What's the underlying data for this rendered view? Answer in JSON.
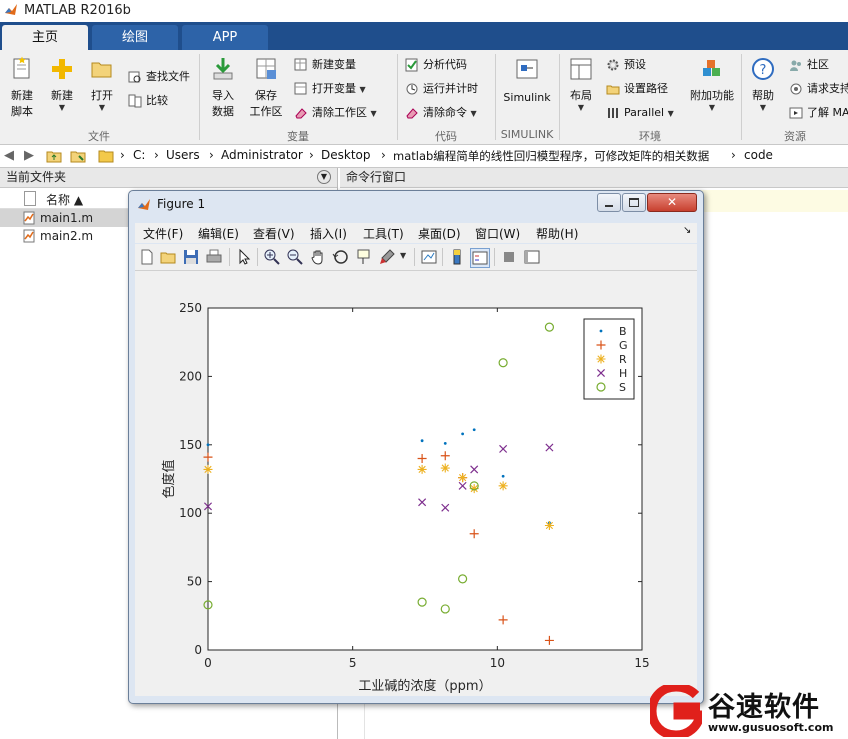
{
  "window": {
    "title": "MATLAB R2016b"
  },
  "tabs": [
    {
      "label": "主页",
      "active": true
    },
    {
      "label": "绘图",
      "active": false
    },
    {
      "label": "APP",
      "active": false
    }
  ],
  "ribbon": {
    "groups": [
      "文件",
      "变量",
      "代码",
      "SIMULINK",
      "环境",
      "资源"
    ],
    "file": {
      "new_script": [
        "新建",
        "脚本"
      ],
      "new": "新建",
      "open": "打开",
      "find_files": "查找文件",
      "compare": "比较"
    },
    "variable": {
      "import": [
        "导入",
        "数据"
      ],
      "save": [
        "保存",
        "工作区"
      ],
      "new_var": "新建变量",
      "open_var": "打开变量",
      "clear_ws": "清除工作区"
    },
    "code": {
      "analyze": "分析代码",
      "run_time": "运行并计时",
      "clear_cmd": "清除命令"
    },
    "simulink": {
      "label": "Simulink"
    },
    "environment": {
      "layout": "布局",
      "prefs": "预设",
      "set_path": "设置路径",
      "parallel": "Parallel",
      "addons": "附加功能"
    },
    "resources": {
      "help": "帮助",
      "community": "社区",
      "request_support": "请求支持",
      "learn": "了解 MA"
    }
  },
  "address": {
    "crumbs": [
      "C:",
      "Users",
      "Administrator",
      "Desktop",
      "matlab编程简单的线性回归模型程序，可修改矩阵的相关数据",
      "code"
    ]
  },
  "current_folder": {
    "header": "当前文件夹",
    "col_name": "名称 ▲",
    "files": [
      "main1.m",
      "main2.m"
    ]
  },
  "command_window": {
    "header": "命令行窗口"
  },
  "figure": {
    "title": "Figure 1",
    "menu": [
      "文件(F)",
      "编辑(E)",
      "查看(V)",
      "插入(I)",
      "工具(T)",
      "桌面(D)",
      "窗口(W)",
      "帮助(H)"
    ]
  },
  "chart_data": {
    "type": "scatter",
    "title": "",
    "xlabel": "工业碱的浓度（ppm）",
    "ylabel": "色度值",
    "xlim": [
      0,
      15
    ],
    "ylim": [
      0,
      250
    ],
    "xticks": [
      0,
      5,
      10,
      15
    ],
    "yticks": [
      0,
      50,
      100,
      150,
      200,
      250
    ],
    "legend_position": "top-right",
    "series": [
      {
        "name": "B",
        "marker": "point",
        "color": "#0072bd",
        "x": [
          0,
          7.4,
          8.2,
          8.8,
          9.2,
          10.2,
          11.8
        ],
        "y": [
          150,
          153,
          151,
          158,
          161,
          127,
          93
        ]
      },
      {
        "name": "G",
        "marker": "plus",
        "color": "#d95319",
        "x": [
          0,
          7.4,
          8.2,
          8.8,
          9.2,
          10.2,
          11.8
        ],
        "y": [
          141,
          140,
          142,
          126,
          85,
          22,
          7
        ]
      },
      {
        "name": "R",
        "marker": "asterisk",
        "color": "#edb120",
        "x": [
          0,
          7.4,
          8.2,
          8.8,
          9.2,
          10.2,
          11.8
        ],
        "y": [
          132,
          132,
          133,
          126,
          118,
          120,
          91
        ]
      },
      {
        "name": "H",
        "marker": "cross",
        "color": "#7e2f8e",
        "x": [
          0,
          7.4,
          8.2,
          8.8,
          9.2,
          10.2,
          11.8
        ],
        "y": [
          105,
          108,
          104,
          120,
          132,
          147,
          148
        ]
      },
      {
        "name": "S",
        "marker": "circle",
        "color": "#77ac30",
        "x": [
          0,
          7.4,
          8.2,
          8.8,
          9.2,
          10.2,
          11.8
        ],
        "y": [
          33,
          35,
          30,
          52,
          120,
          210,
          236
        ]
      }
    ]
  },
  "watermark": {
    "name": "谷速软件",
    "url": "www.gusuosoft.com"
  }
}
